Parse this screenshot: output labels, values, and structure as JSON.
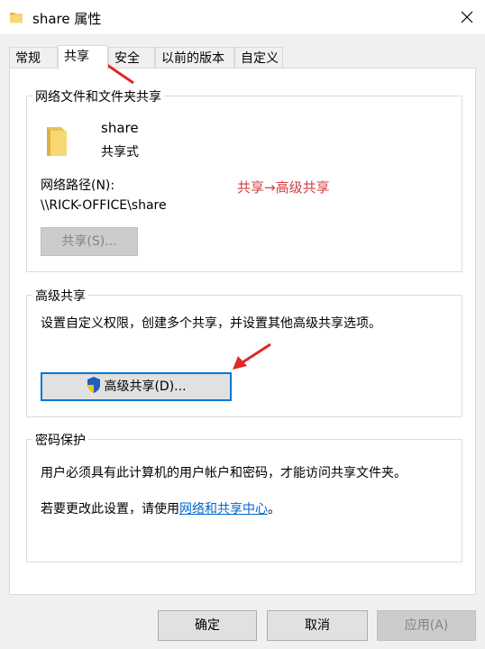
{
  "window": {
    "title": "share 属性"
  },
  "tabs": [
    {
      "label": "常规"
    },
    {
      "label": "共享"
    },
    {
      "label": "安全"
    },
    {
      "label": "以前的版本"
    },
    {
      "label": "自定义"
    }
  ],
  "network_sharing": {
    "legend": "网络文件和文件夹共享",
    "folder_name": "share",
    "folder_status": "共享式",
    "path_label": "网络路径(N):",
    "path_value": "\\\\RICK-OFFICE\\share",
    "share_button": "共享(S)..."
  },
  "annotation": {
    "text": "共享→高级共享"
  },
  "advanced_sharing": {
    "legend": "高级共享",
    "description": "设置自定义权限，创建多个共享，并设置其他高级共享选项。",
    "button": "高级共享(D)..."
  },
  "password_protection": {
    "legend": "密码保护",
    "description": "用户必须具有此计算机的用户帐户和密码，才能访问共享文件夹。",
    "change_prefix": "若要更改此设置，请使用",
    "link_text": "网络和共享中心",
    "change_suffix": "。"
  },
  "footer": {
    "ok": "确定",
    "cancel": "取消",
    "apply": "应用(A)"
  },
  "colors": {
    "accent": "#0078d7",
    "folder": "#f8d775",
    "annotation": "#d04040",
    "link": "#0066cc"
  },
  "icons": {
    "title": "folder-icon",
    "close": "close-icon",
    "folder_large": "folder-icon",
    "shield": "uac-shield-icon"
  }
}
